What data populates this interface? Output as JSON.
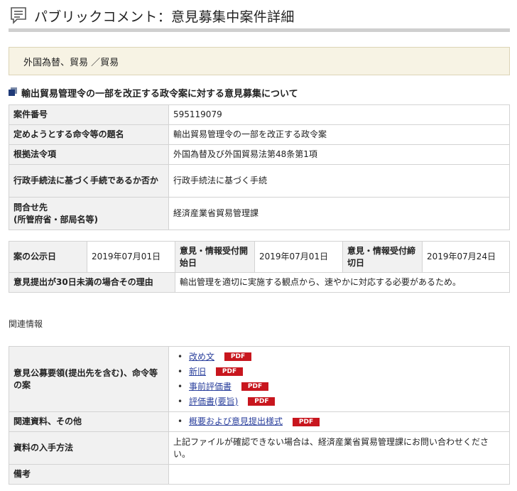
{
  "page": {
    "title": "パブリックコメント：意見募集中案件詳細",
    "category": "外国為替、貿易 ／貿易",
    "heading": "輸出貿易管理令の一部を改正する政令案に対する意見募集について"
  },
  "info_rows": [
    {
      "label": "案件番号",
      "value": "595119079"
    },
    {
      "label": "定めようとする命令等の題名",
      "value": "輸出貿易管理令の一部を改正する政令案"
    },
    {
      "label": "根拠法令項",
      "value": "外国為替及び外国貿易法第48条第1項"
    },
    {
      "label": "行政手続法に基づく手続であるか否か",
      "value": "行政手続法に基づく手続"
    },
    {
      "label": "問合せ先\n(所管府省・部局名等)",
      "value": "経済産業省貿易管理課"
    }
  ],
  "dates": {
    "publish_label": "案の公示日",
    "publish_value": "2019年07月01日",
    "start_label": "意見・情報受付開始日",
    "start_value": "2019年07月01日",
    "end_label": "意見・情報受付締切日",
    "end_value": "2019年07月24日",
    "reason_label": "意見提出が30日未満の場合その理由",
    "reason_value": "輸出管理を適切に実施する観点から、速やかに対応する必要があるため。"
  },
  "related": {
    "section_label": "関連情報",
    "pdf_label": "PDF",
    "guidelines_label": "意見公募要領(提出先を含む)、命令等の案",
    "guidelines_links": [
      "改め文",
      "新旧",
      "事前評価書",
      "評価書(要旨)"
    ],
    "materials_label": "関連資料、その他",
    "materials_links": [
      "概要および意見提出様式"
    ],
    "obtain_label": "資料の入手方法",
    "obtain_value": "上記ファイルが確認できない場合は、経済産業省貿易管理課にお問い合わせください。",
    "remarks_label": "備考",
    "remarks_value": ""
  },
  "colors": {
    "accent_band": "#f7f3e4",
    "header_cell": "#f1f1f1",
    "pdf_badge": "#c8161e",
    "link": "#2a3f9c"
  }
}
